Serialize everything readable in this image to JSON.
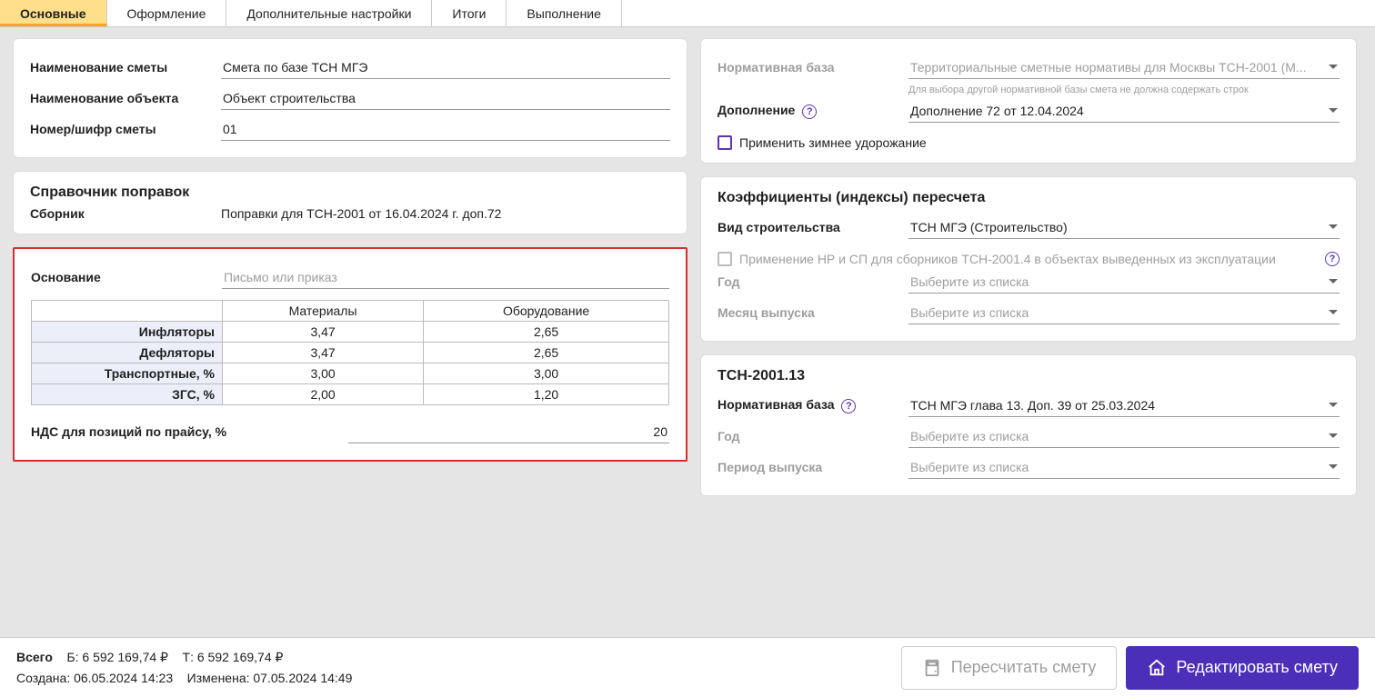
{
  "tabs": [
    "Основные",
    "Оформление",
    "Дополнительные настройки",
    "Итоги",
    "Выполнение"
  ],
  "left": {
    "name_label": "Наименование сметы",
    "name_value": "Смета по базе ТСН МГЭ",
    "object_label": "Наименование объекта",
    "object_value": "Объект строительства",
    "number_label": "Номер/шифр сметы",
    "number_value": "01"
  },
  "corrections": {
    "title": "Справочник поправок",
    "sub_label": "Сборник",
    "sub_value": "Поправки для ТСН-2001 от 16.04.2024 г. доп.72"
  },
  "basis": {
    "label": "Основание",
    "placeholder": "Письмо или приказ",
    "headers": [
      "Материалы",
      "Оборудование"
    ],
    "rows": [
      {
        "name": "Инфляторы",
        "v": [
          "3,47",
          "2,65"
        ]
      },
      {
        "name": "Дефляторы",
        "v": [
          "3,47",
          "2,65"
        ]
      },
      {
        "name": "Транспортные, %",
        "v": [
          "3,00",
          "3,00"
        ]
      },
      {
        "name": "ЗГС, %",
        "v": [
          "2,00",
          "1,20"
        ]
      }
    ],
    "vat_label": "НДС для позиций по прайсу, %",
    "vat_value": "20"
  },
  "norm": {
    "base_label": "Нормативная база",
    "base_value": "Территориальные сметные нормативы для Москвы ТСН-2001 (М...",
    "base_hint": "Для выбора другой нормативной базы смета не должна содержать строк",
    "add_label": "Дополнение",
    "add_value": "Дополнение 72 от 12.04.2024",
    "winter_label": "Применить зимнее удорожание"
  },
  "coef": {
    "title": "Коэффициенты (индексы) пересчета",
    "type_label": "Вид строительства",
    "type_value": "ТСН МГЭ (Строительство)",
    "nrsp_label": "Применение НР и СП для сборников ТСН-2001.4 в объектах выведенных из эксплуатации",
    "year_label": "Год",
    "list_placeholder": "Выберите из списка",
    "month_label": "Месяц выпуска"
  },
  "tsn13": {
    "title": "ТСН-2001.13",
    "base_label": "Нормативная база",
    "base_value": "ТСН МГЭ глава 13. Доп. 39 от 25.03.2024",
    "year_label": "Год",
    "period_label": "Период выпуска",
    "list_placeholder": "Выберите из списка"
  },
  "footer": {
    "total_label": "Всего",
    "b": "Б: 6 592 169,74 ₽",
    "t": "Т: 6 592 169,74 ₽",
    "created_label": "Создана:",
    "created_value": "06.05.2024 14:23",
    "modified_label": "Изменена:",
    "modified_value": "07.05.2024 14:49",
    "recalc": "Пересчитать смету",
    "edit": "Редактировать смету"
  }
}
